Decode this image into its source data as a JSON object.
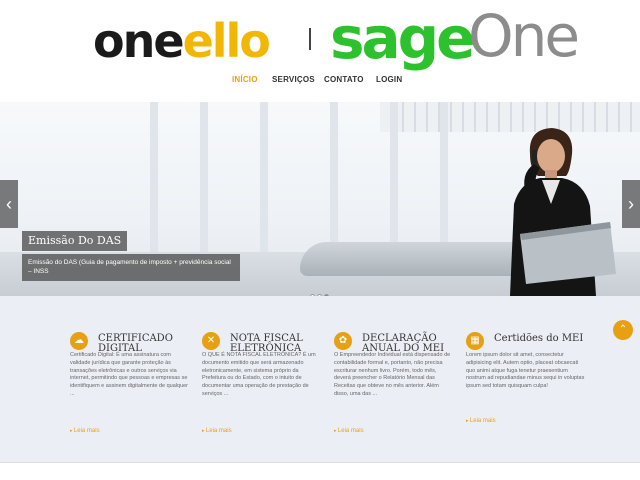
{
  "brand": {
    "logo_oneello": "oneello",
    "logo_sage": "sage",
    "logo_one": "One"
  },
  "nav": {
    "items": [
      "INÍCIO",
      "SERVIÇOS",
      "CONTATO",
      "LOGIN"
    ],
    "active": "INÍCIO",
    "accent_color": "#e8a013"
  },
  "slider": {
    "caption_title": "Emissão Do DAS",
    "caption_text": "Emissão do DAS (Guia de pagamento de imposto + previdência social – INSS",
    "prev_icon": "chevron-left-icon",
    "next_icon": "chevron-right-icon",
    "slide_count": 3,
    "active_slide": 3
  },
  "services": [
    {
      "icon": "cloud-icon",
      "title": "CERTIFICADO DIGITAL",
      "body": "Certificado Digital: É uma assinatura com validade jurídica que garante proteção às transações eletrônicas e outros serviços via internet, permitindo que pessoas e empresas se identifiquem e assinem digitalmente de qualquer ...",
      "more": "Leia mais"
    },
    {
      "icon": "tools-icon",
      "title": "NOTA FISCAL ELETRÔNICA",
      "body": "O QUE É NOTA FISCAL ELETRÔNICA? É um documento emitido que será armazenado eletronicamente, em sistema próprio da Prefeitura ou do Estado, com o intuito de documentar uma operação de prestação de serviços ...",
      "more": "Leia mais"
    },
    {
      "icon": "gears-icon",
      "title": "DECLARAÇÃO ANUAL DO MEI",
      "body": "O Empreendedor Individual está dispensado de contabilidade formal e, portanto, não precisa escriturar nenhum livro. Porém, todo mês, deverá preencher o Relatório Mensal das Receitas que obteve no mês anterior. Além disso, uma das ...",
      "more": "Leia mais"
    },
    {
      "icon": "grid-icon",
      "title": "Certidões do MEI",
      "body": "Lorem ipsum dolor sit amet, consectetur adipisicing elit. Autem optio, placeat obcaecati quo animi atque fuga tenetur praesentium nostrum ad repudiandae minus sequi in voluptas ipsum sed totam quisquam culpa!",
      "more": "Leia mais"
    }
  ],
  "back_to_top_icon": "chevron-up-icon"
}
